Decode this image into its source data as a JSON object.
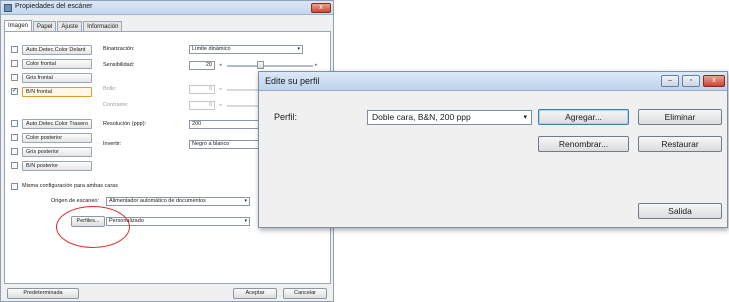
{
  "scanner_window": {
    "title": "Propiedades del escáner",
    "close_glyph": "x",
    "tabs": [
      "Imagen",
      "Papel",
      "Ajuste",
      "Información"
    ],
    "image_types": [
      {
        "label": "Auto.Detec.Color Delant",
        "checked": false
      },
      {
        "label": "Color frontal",
        "checked": false
      },
      {
        "label": "Gris frontal",
        "checked": false
      },
      {
        "label": "B/N frontal",
        "checked": true
      },
      {
        "label": "Auto.Detec.Color Trasero",
        "checked": false
      },
      {
        "label": "Color posterior",
        "checked": false
      },
      {
        "label": "Gris posterior",
        "checked": false
      },
      {
        "label": "B/N posterior",
        "checked": false
      }
    ],
    "check_glyph": "✓",
    "settings": {
      "binarization_label": "Binarización:",
      "binarization_value": "Límite dinámico",
      "sensitivity_label": "Sensibilidad:",
      "sensitivity_value": "20",
      "brightness_label": "Brillo:",
      "brightness_value": "0",
      "contrast_label": "Contraste:",
      "contrast_value": "0",
      "resolution_label": "Resolución (ppp):",
      "resolution_value": "200",
      "invert_label": "Invertir:",
      "invert_value": "Negro a blanco"
    },
    "same_config_label": "Misma configuración para ambas caras",
    "scan_source_label": "Origen de escaneo:",
    "scan_source_value": "Alimentador automático de documentos",
    "profiles_button": "Perfiles...",
    "profile_value": "Personalizado",
    "default_button": "Predeterminada",
    "accept_button": "Aceptar",
    "cancel_button": "Cancelar",
    "dropdown_arrow": "▾",
    "slider_left_arrow": "◂",
    "slider_right_arrow": "▸",
    "highlight_color": "#d92b2b"
  },
  "profile_dialog": {
    "title": "Edite su perfil",
    "minimize_glyph": "–",
    "maximize_glyph": "▫",
    "close_glyph": "x",
    "profile_label": "Perfil:",
    "profile_value": "Doble cara, B&N, 200 ppp",
    "add_button": "Agregar...",
    "delete_button": "Eliminar",
    "rename_button": "Renombrar...",
    "restore_button": "Restaurar",
    "exit_button": "Salida",
    "dropdown_arrow": "▾"
  }
}
